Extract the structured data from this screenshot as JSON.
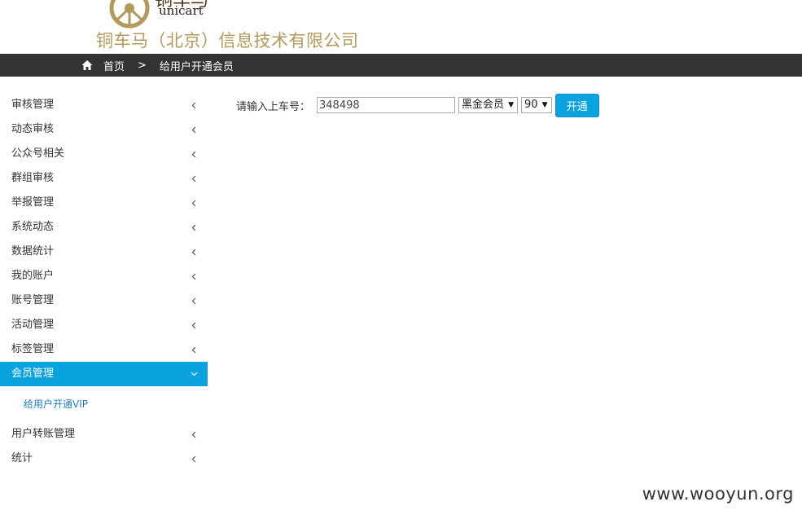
{
  "header": {
    "logo": {
      "wordmark_cn": "铜车马",
      "wordmark_en": "unicart"
    },
    "company_name": "铜车马（北京）信息技术有限公司"
  },
  "breadcrumb": {
    "home_label": "首页",
    "separator": ">",
    "current": "给用户开通会员"
  },
  "sidebar": {
    "items": [
      {
        "label": "审核管理",
        "expanded": false
      },
      {
        "label": "动态审核",
        "expanded": false
      },
      {
        "label": "公众号相关",
        "expanded": false
      },
      {
        "label": "群组审核",
        "expanded": false
      },
      {
        "label": "举报管理",
        "expanded": false
      },
      {
        "label": "系统动态",
        "expanded": false
      },
      {
        "label": "数据统计",
        "expanded": false
      },
      {
        "label": "我的账户",
        "expanded": false
      },
      {
        "label": "账号管理",
        "expanded": false
      },
      {
        "label": "活动管理",
        "expanded": false
      },
      {
        "label": "标签管理",
        "expanded": false
      },
      {
        "label": "会员管理",
        "expanded": true,
        "active": true,
        "subitems": [
          {
            "label": "给用户开通VIP"
          }
        ]
      },
      {
        "label": "用户转账管理",
        "expanded": false
      },
      {
        "label": "统计",
        "expanded": false
      }
    ]
  },
  "form": {
    "label": "请输入上车号：",
    "input_value": "348498",
    "membership_select": "黑金会员",
    "days_select": "90",
    "submit_label": "开通"
  },
  "watermark": "www.wooyun.org",
  "colors": {
    "accent": "#09a3df",
    "topbar": "#333333",
    "company_gold": "#b49a5a"
  }
}
